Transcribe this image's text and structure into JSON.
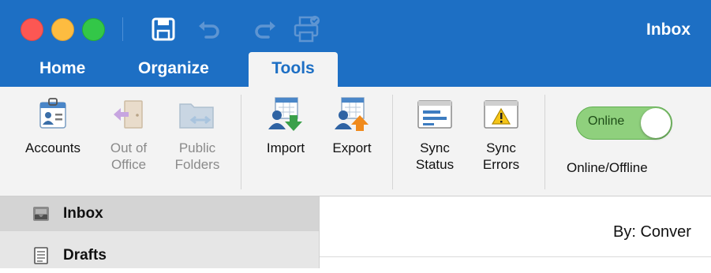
{
  "window": {
    "title": "Inbox"
  },
  "quick_access": {
    "icons": [
      "save-icon",
      "undo-icon",
      "redo-icon",
      "print-icon"
    ]
  },
  "tabs": [
    {
      "label": "Home",
      "active": false
    },
    {
      "label": "Organize",
      "active": false
    },
    {
      "label": "Tools",
      "active": true
    }
  ],
  "ribbon": {
    "buttons": [
      {
        "label": "Accounts",
        "icon": "accounts-icon",
        "enabled": true
      },
      {
        "label": "Out of\nOffice",
        "icon": "out-of-office-icon",
        "enabled": false
      },
      {
        "label": "Public\nFolders",
        "icon": "public-folders-icon",
        "enabled": false
      },
      {
        "label": "Import",
        "icon": "import-icon",
        "enabled": true
      },
      {
        "label": "Export",
        "icon": "export-icon",
        "enabled": true
      },
      {
        "label": "Sync\nStatus",
        "icon": "sync-status-icon",
        "enabled": true
      },
      {
        "label": "Sync\nErrors",
        "icon": "sync-errors-icon",
        "enabled": true
      }
    ],
    "online_toggle": {
      "state_text": "Online",
      "label": "Online/Offline",
      "on": true
    }
  },
  "sidebar": {
    "items": [
      {
        "label": "Inbox",
        "icon": "inbox-icon",
        "selected": true
      },
      {
        "label": "Drafts",
        "icon": "drafts-icon",
        "selected": false
      }
    ]
  },
  "message_list": {
    "sort_label": "By: Conver"
  },
  "colors": {
    "title_bar": "#1d6fc4",
    "ribbon": "#f3f3f3",
    "sidebar": "#e6e6e6",
    "toggle_on": "#8fd07d"
  }
}
